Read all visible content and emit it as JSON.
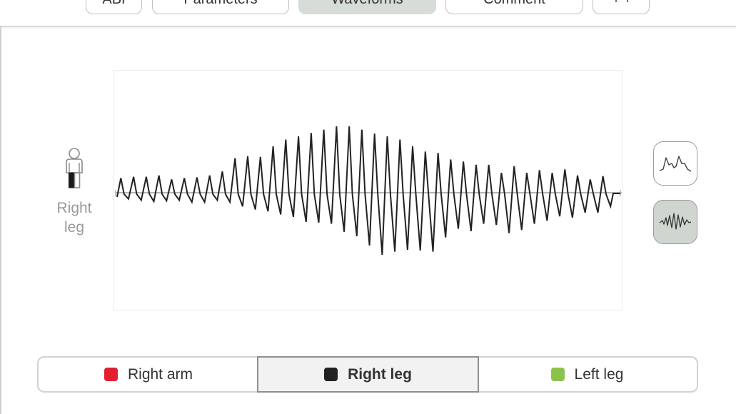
{
  "tabs": [
    {
      "label": "ABI",
      "active": false
    },
    {
      "label": "Parameters",
      "active": false
    },
    {
      "label": "Waveforms",
      "active": true
    },
    {
      "label": "Comment",
      "active": false
    },
    {
      "label": "+",
      "active": false
    }
  ],
  "limb": {
    "label_line1": "Right",
    "label_line2": "leg",
    "icon": "person-leg-icon"
  },
  "view_buttons": [
    {
      "icon": "averaged-waveform-icon",
      "active": false
    },
    {
      "icon": "raw-oscillation-icon",
      "active": true
    }
  ],
  "channels": [
    {
      "label": "Right arm",
      "color": "#e02030",
      "active": false
    },
    {
      "label": "Right leg",
      "color": "#222222",
      "active": true
    },
    {
      "label": "Left leg",
      "color": "#8bc34a",
      "active": false
    }
  ],
  "chart_data": {
    "type": "line",
    "title": "",
    "xlabel": "",
    "ylabel": "",
    "series": [
      {
        "color": "#222222",
        "peaks": [
          0.22,
          0.24,
          0.24,
          0.26,
          0.2,
          0.22,
          0.23,
          0.26,
          0.32,
          0.52,
          0.55,
          0.54,
          0.7,
          0.8,
          0.85,
          0.9,
          0.95,
          1.0,
          1.0,
          0.95,
          0.89,
          0.85,
          0.8,
          0.7,
          0.62,
          0.6,
          0.5,
          0.47,
          0.42,
          0.42,
          0.3,
          0.4,
          0.3,
          0.34,
          0.3,
          0.35,
          0.26,
          0.2,
          0.25
        ],
        "troughs": [
          0.1,
          0.12,
          0.14,
          0.13,
          0.12,
          0.15,
          0.15,
          0.12,
          0.15,
          0.22,
          0.27,
          0.3,
          0.35,
          0.39,
          0.47,
          0.48,
          0.5,
          0.63,
          0.7,
          0.85,
          1.0,
          0.95,
          0.92,
          0.93,
          0.95,
          0.72,
          0.58,
          0.62,
          0.5,
          0.52,
          0.65,
          0.6,
          0.5,
          0.45,
          0.38,
          0.4,
          0.32,
          0.32,
          0.22
        ]
      }
    ],
    "baseline": 0
  }
}
